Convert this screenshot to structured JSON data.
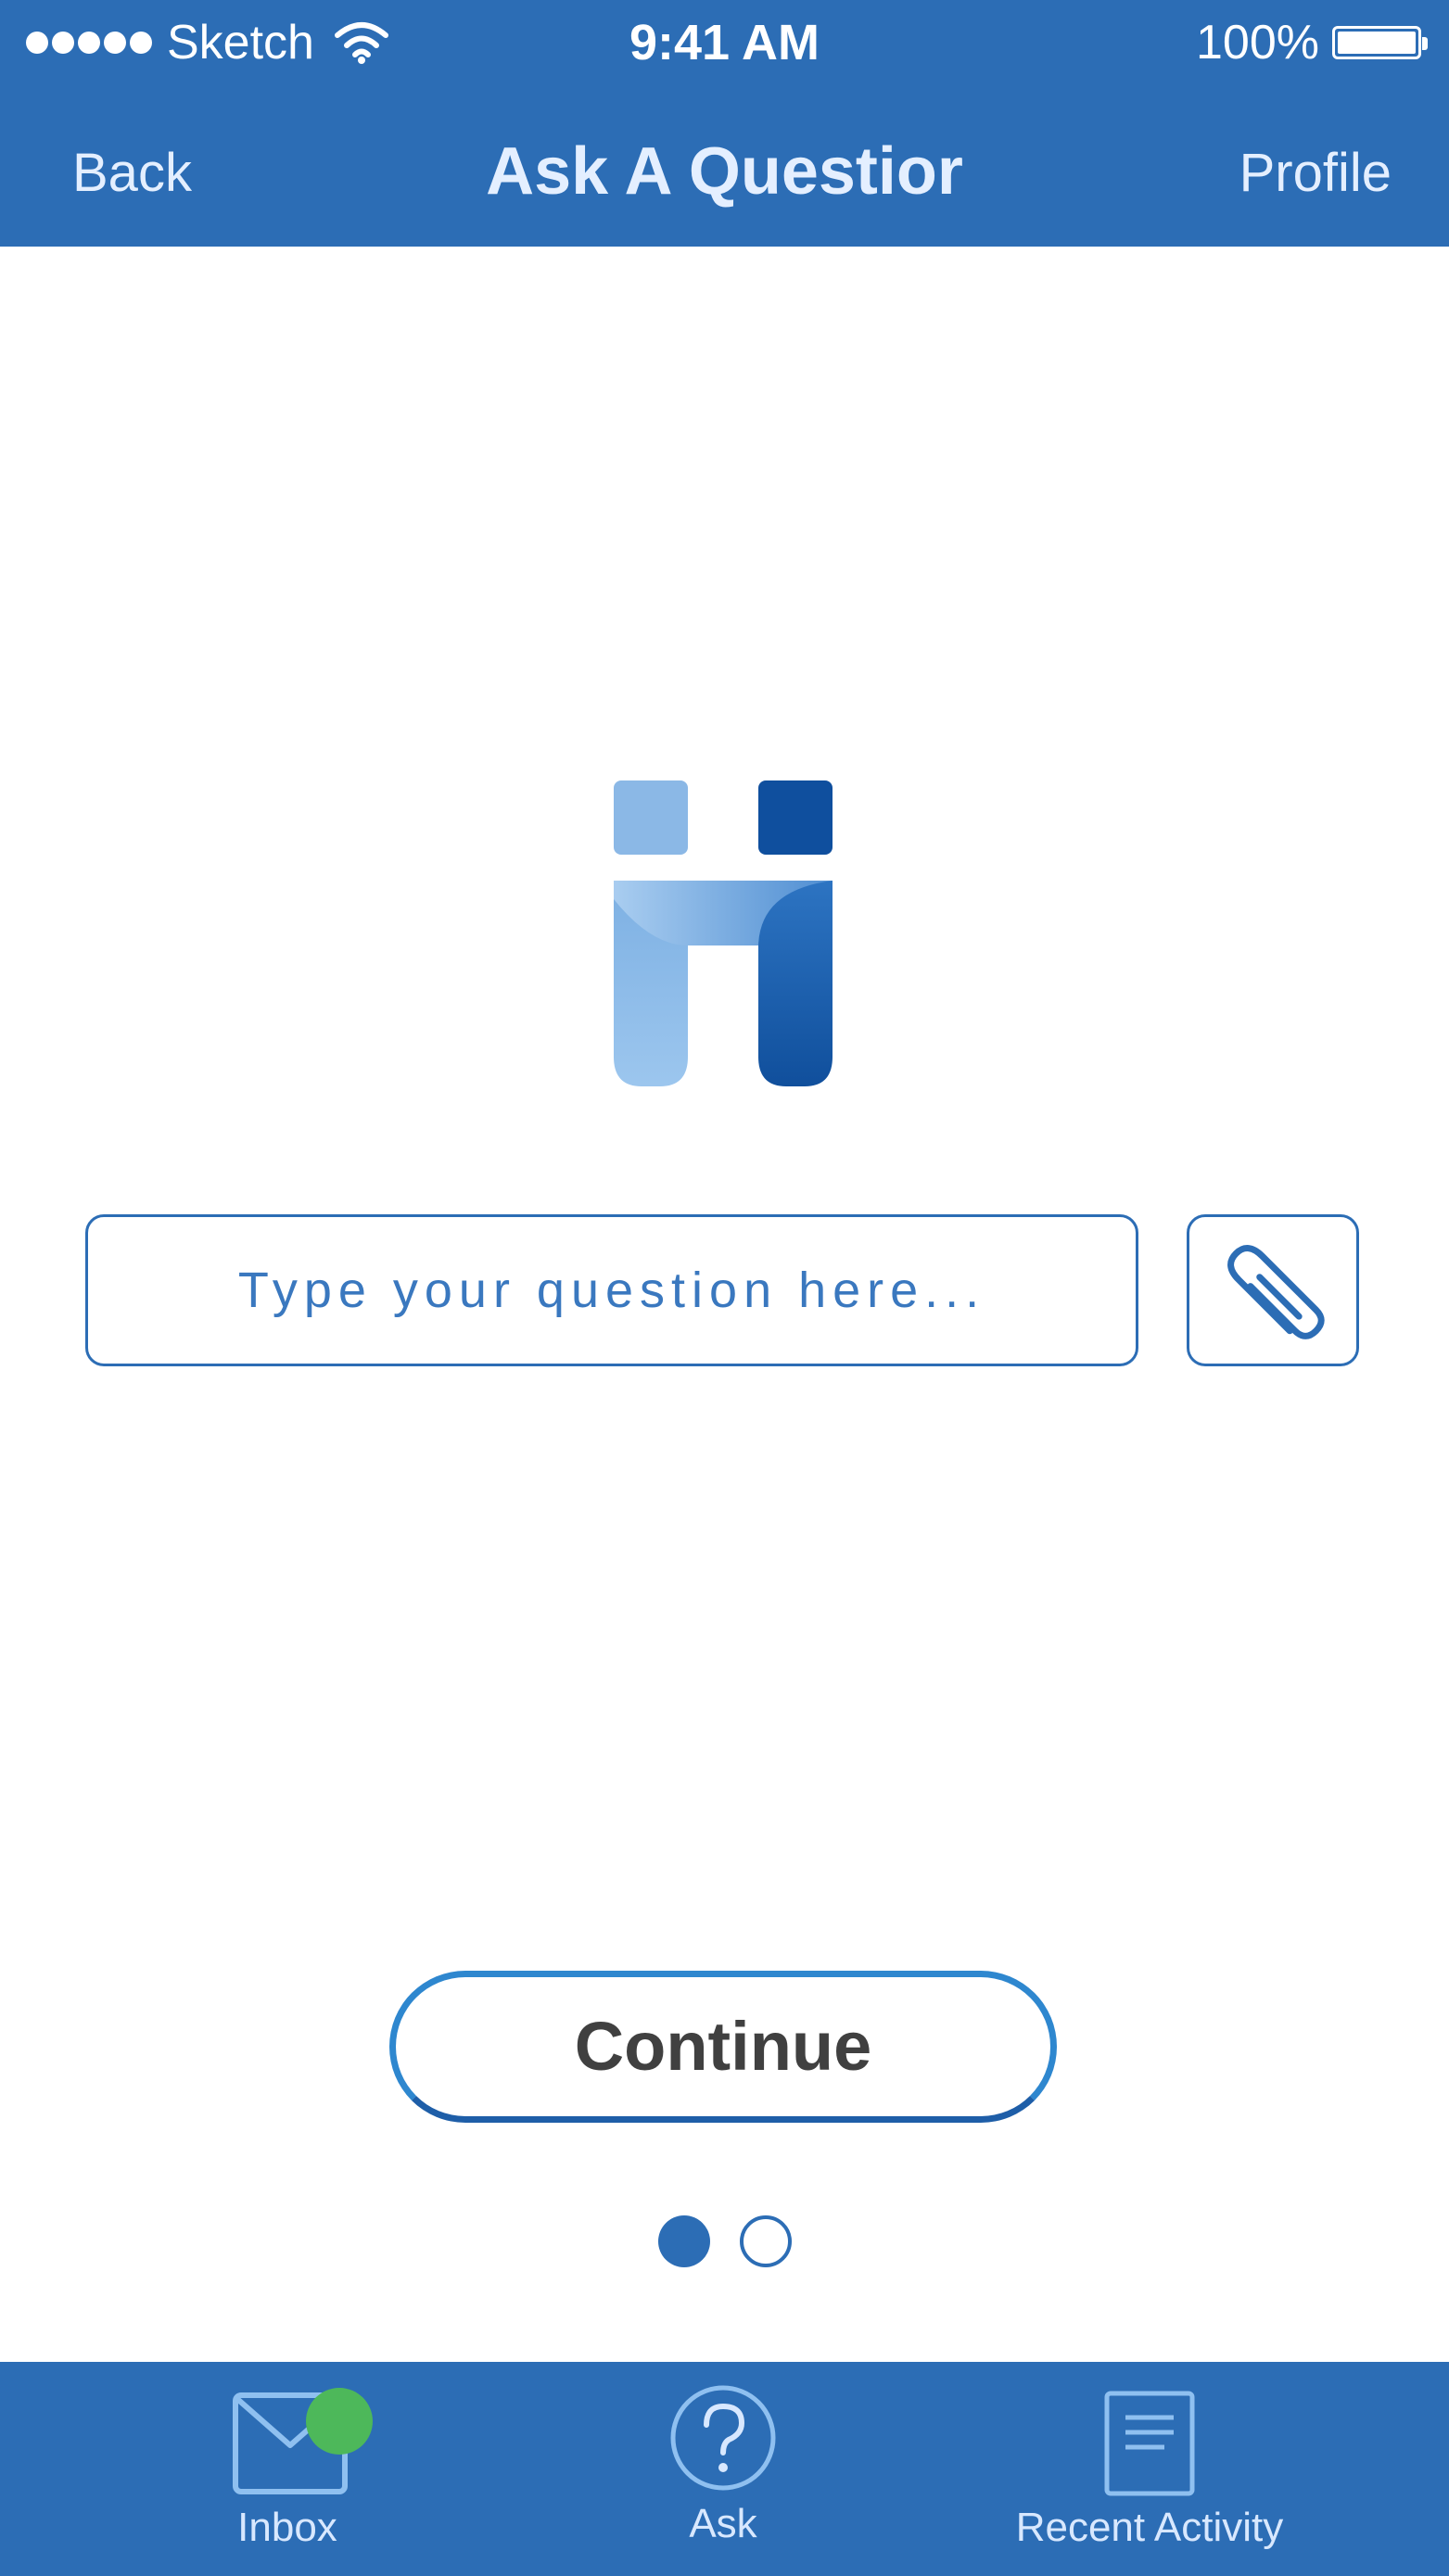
{
  "status_bar": {
    "carrier": "Sketch",
    "time": "9:41 AM",
    "battery": "100%",
    "signal_icon": "signal-dots-icon",
    "wifi_icon": "wifi-icon",
    "battery_icon": "battery-icon"
  },
  "nav": {
    "back_label": "Back",
    "title": "Ask A Questior",
    "profile_label": "Profile"
  },
  "logo": {
    "icon": "hi-logo-icon"
  },
  "question": {
    "placeholder": "Type your question here...",
    "value": ""
  },
  "attach": {
    "icon": "paperclip-icon"
  },
  "continue_label": "Continue",
  "pagination": {
    "current": 1,
    "total": 2
  },
  "tab_bar": {
    "tabs": [
      {
        "label": "Inbox",
        "icon": "envelope-icon",
        "has_notification": true
      },
      {
        "label": "Ask",
        "icon": "question-circle-icon"
      },
      {
        "label": "Recent Activity",
        "icon": "document-icon"
      }
    ]
  },
  "colors": {
    "primary": "#2c6db5",
    "notification": "#4db85a",
    "button_text": "#404040",
    "logo_light": "#8bb8e6",
    "logo_dark": "#0f4f9e"
  }
}
